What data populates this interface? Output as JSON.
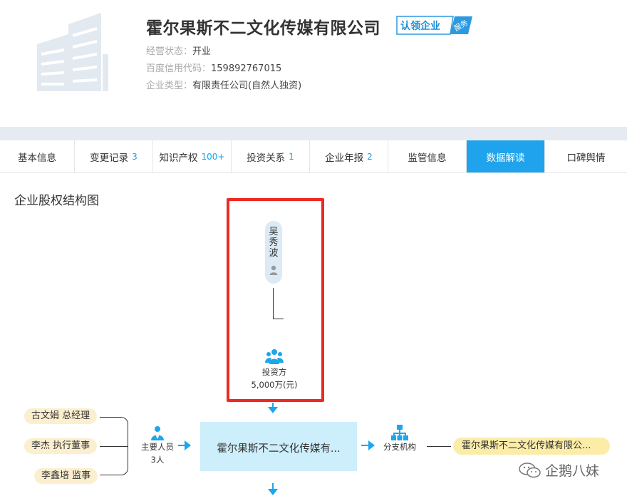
{
  "company": {
    "name": "霍尔果斯不二文化传媒有限公司",
    "claim_badge": "认领企业",
    "claim_badge_tag": "服务",
    "status_label": "经营状态：",
    "status_value": "开业",
    "credit_label": "百度信用代码：",
    "credit_value": "159892767015",
    "type_label": "企业类型：",
    "type_value": "有限责任公司(自然人独资)"
  },
  "tabs": [
    {
      "label": "基本信息",
      "count": ""
    },
    {
      "label": "变更记录",
      "count": "3"
    },
    {
      "label": "知识产权",
      "count": "100+"
    },
    {
      "label": "投资关系",
      "count": "1"
    },
    {
      "label": "企业年报",
      "count": "2"
    },
    {
      "label": "监管信息",
      "count": ""
    },
    {
      "label": "数据解读",
      "count": "",
      "active": true
    },
    {
      "label": "口碑舆情",
      "count": ""
    }
  ],
  "section_title": "企业股权结构图",
  "diagram": {
    "investor_name": "吴秀波",
    "investor_group_label": "投资方",
    "investor_amount": "5,000万(元)",
    "center_company": "霍尔果斯不二文化传媒有...",
    "staff": [
      {
        "text": "古文娟 总经理"
      },
      {
        "text": "李杰 执行董事"
      },
      {
        "text": "李鑫培 监事"
      }
    ],
    "staff_label": "主要人员",
    "staff_count": "3人",
    "branch_label": "分支机构",
    "branch_company": "霍尔果斯不二文化传媒有限公..."
  },
  "watermark": "企鹅八妹",
  "colors": {
    "accent": "#1ea3ec",
    "highlight": "#ec2a22",
    "center_box": "#cdeefb",
    "staff_pill": "#fbefd0",
    "branch_pill": "#fbeca8"
  }
}
